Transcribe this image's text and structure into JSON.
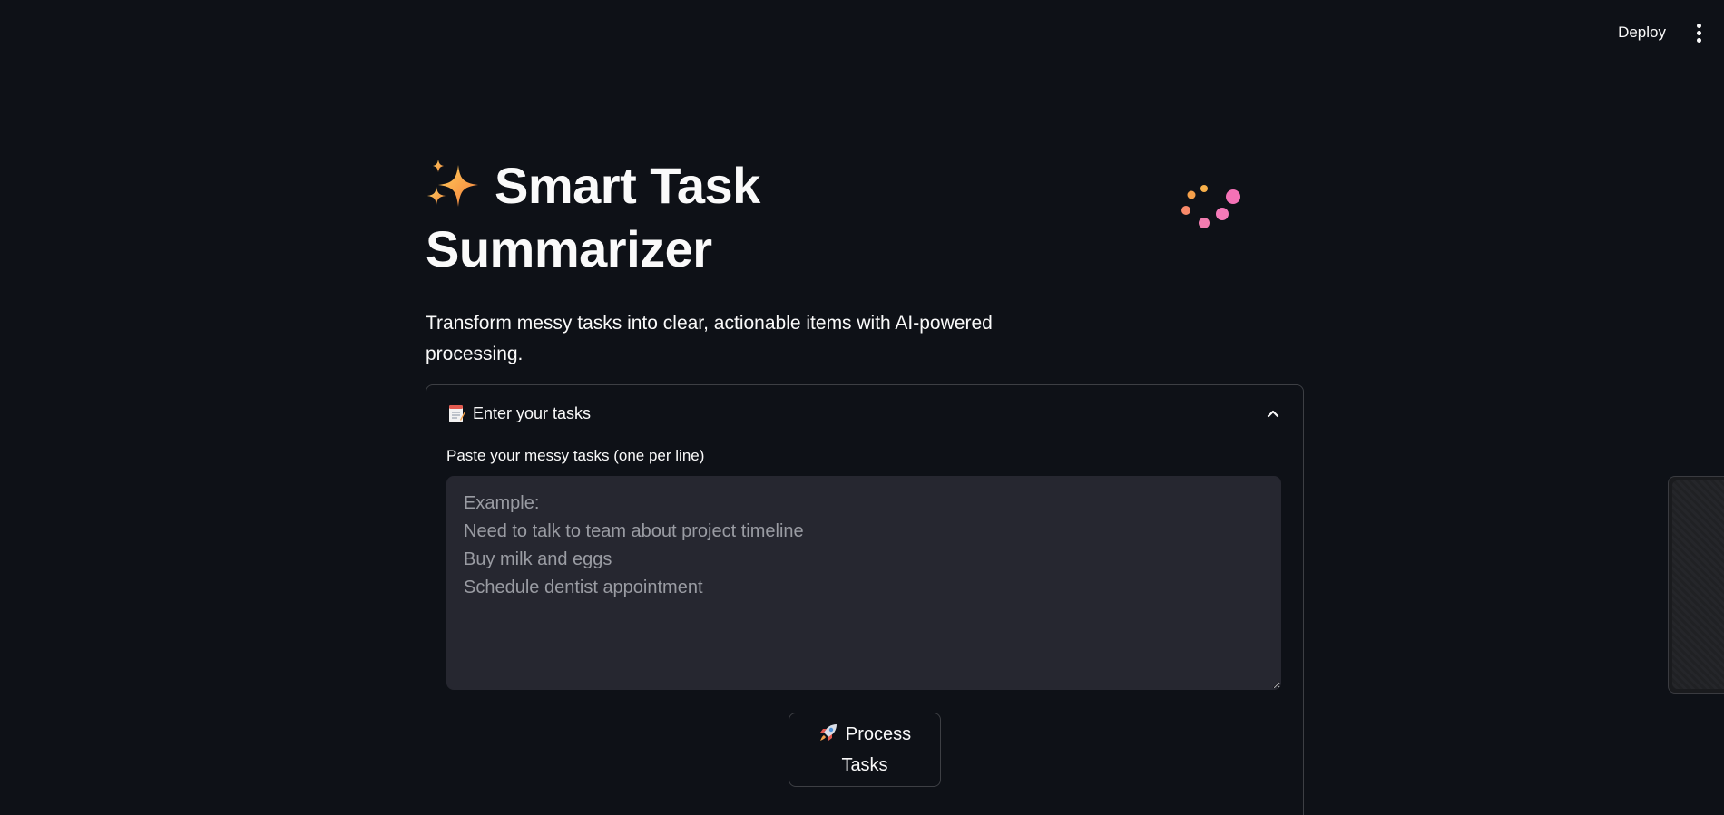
{
  "header": {
    "deploy_label": "Deploy",
    "menu_icon": "vertical-dots-icon"
  },
  "main": {
    "title_icon": "sparkles-icon",
    "title": "Smart Task Summarizer",
    "loading_icon": "loading-dots-icon",
    "subtitle": "Transform messy tasks into clear, actionable items with AI-powered processing."
  },
  "expander": {
    "icon": "memo-icon",
    "title": "Enter your tasks",
    "expanded": true,
    "collapse_icon": "chevron-up-icon",
    "textarea_label": "Paste your messy tasks (one per line)",
    "textarea_value": "",
    "textarea_placeholder": "Example:\nNeed to talk to team about project timeline\nBuy milk and eggs\nSchedule dentist appointment",
    "button_icon": "rocket-icon",
    "button_label": "Process Tasks"
  },
  "colors": {
    "background": "#0e1117",
    "text": "#fafafa",
    "input_background": "#262730",
    "placeholder": "#9a9ca3",
    "spinner_orange": "#f5a04a",
    "spinner_pink": "#f472b6"
  }
}
